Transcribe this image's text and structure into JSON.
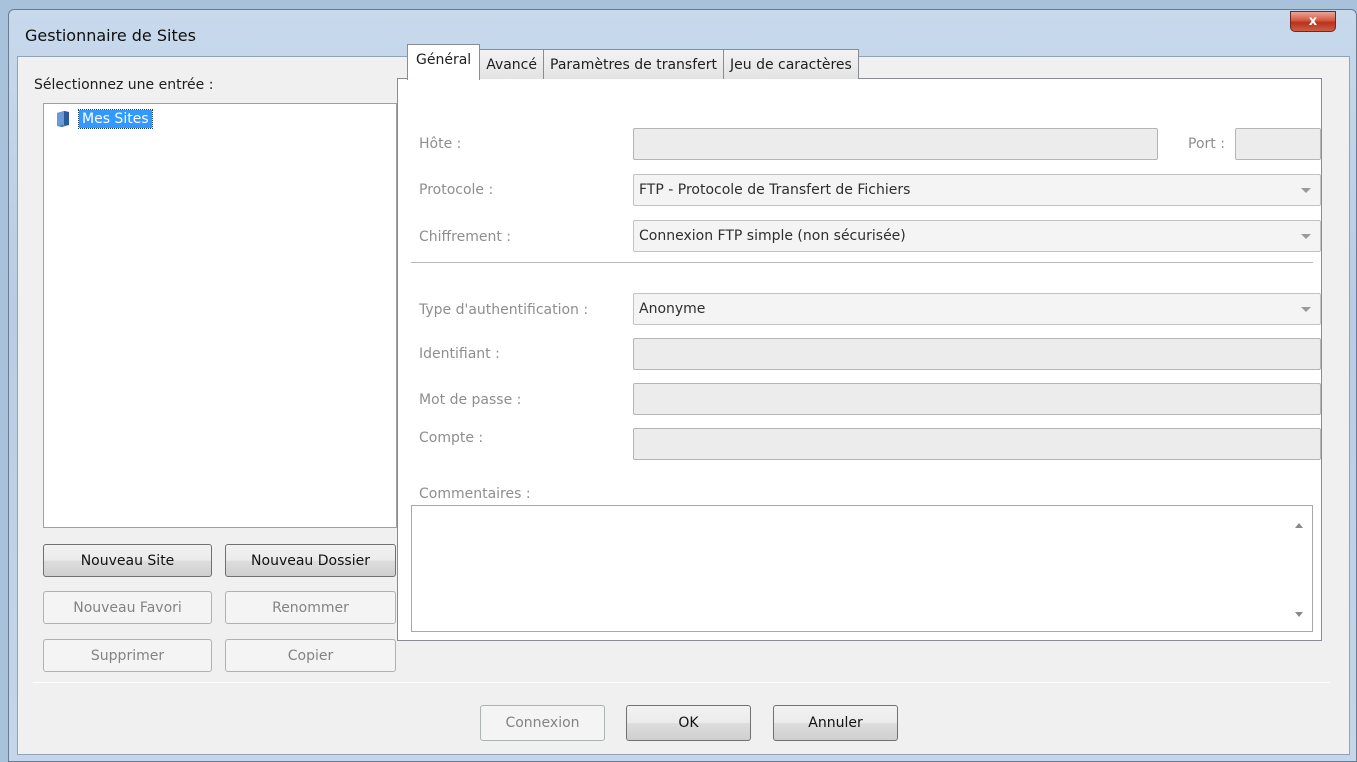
{
  "window": {
    "title": "Gestionnaire de Sites",
    "close_glyph": "x"
  },
  "left": {
    "select_label": "Sélectionnez une entrée :",
    "tree": [
      {
        "label": "Mes Sites",
        "icon": "folder-icon"
      }
    ],
    "buttons": {
      "new_site": "Nouveau Site",
      "new_folder": "Nouveau Dossier",
      "new_bookmark": "Nouveau Favori",
      "rename": "Renommer",
      "delete": "Supprimer",
      "copy": "Copier"
    }
  },
  "tabs": [
    "Général",
    "Avancé",
    "Paramètres de transfert",
    "Jeu de caractères"
  ],
  "general": {
    "host_label": "Hôte :",
    "host_value": "",
    "port_label": "Port :",
    "port_value": "",
    "protocol_label": "Protocole :",
    "protocol_value": "FTP - Protocole de Transfert de Fichiers",
    "encryption_label": "Chiffrement :",
    "encryption_value": "Connexion FTP simple (non sécurisée)",
    "auth_label": "Type d'authentification :",
    "auth_value": "Anonyme",
    "user_label": "Identifiant :",
    "password_label": "Mot de passe :",
    "account_label": "Compte :",
    "comments_label": "Commentaires :"
  },
  "footer": {
    "connect": "Connexion",
    "ok": "OK",
    "cancel": "Annuler"
  }
}
